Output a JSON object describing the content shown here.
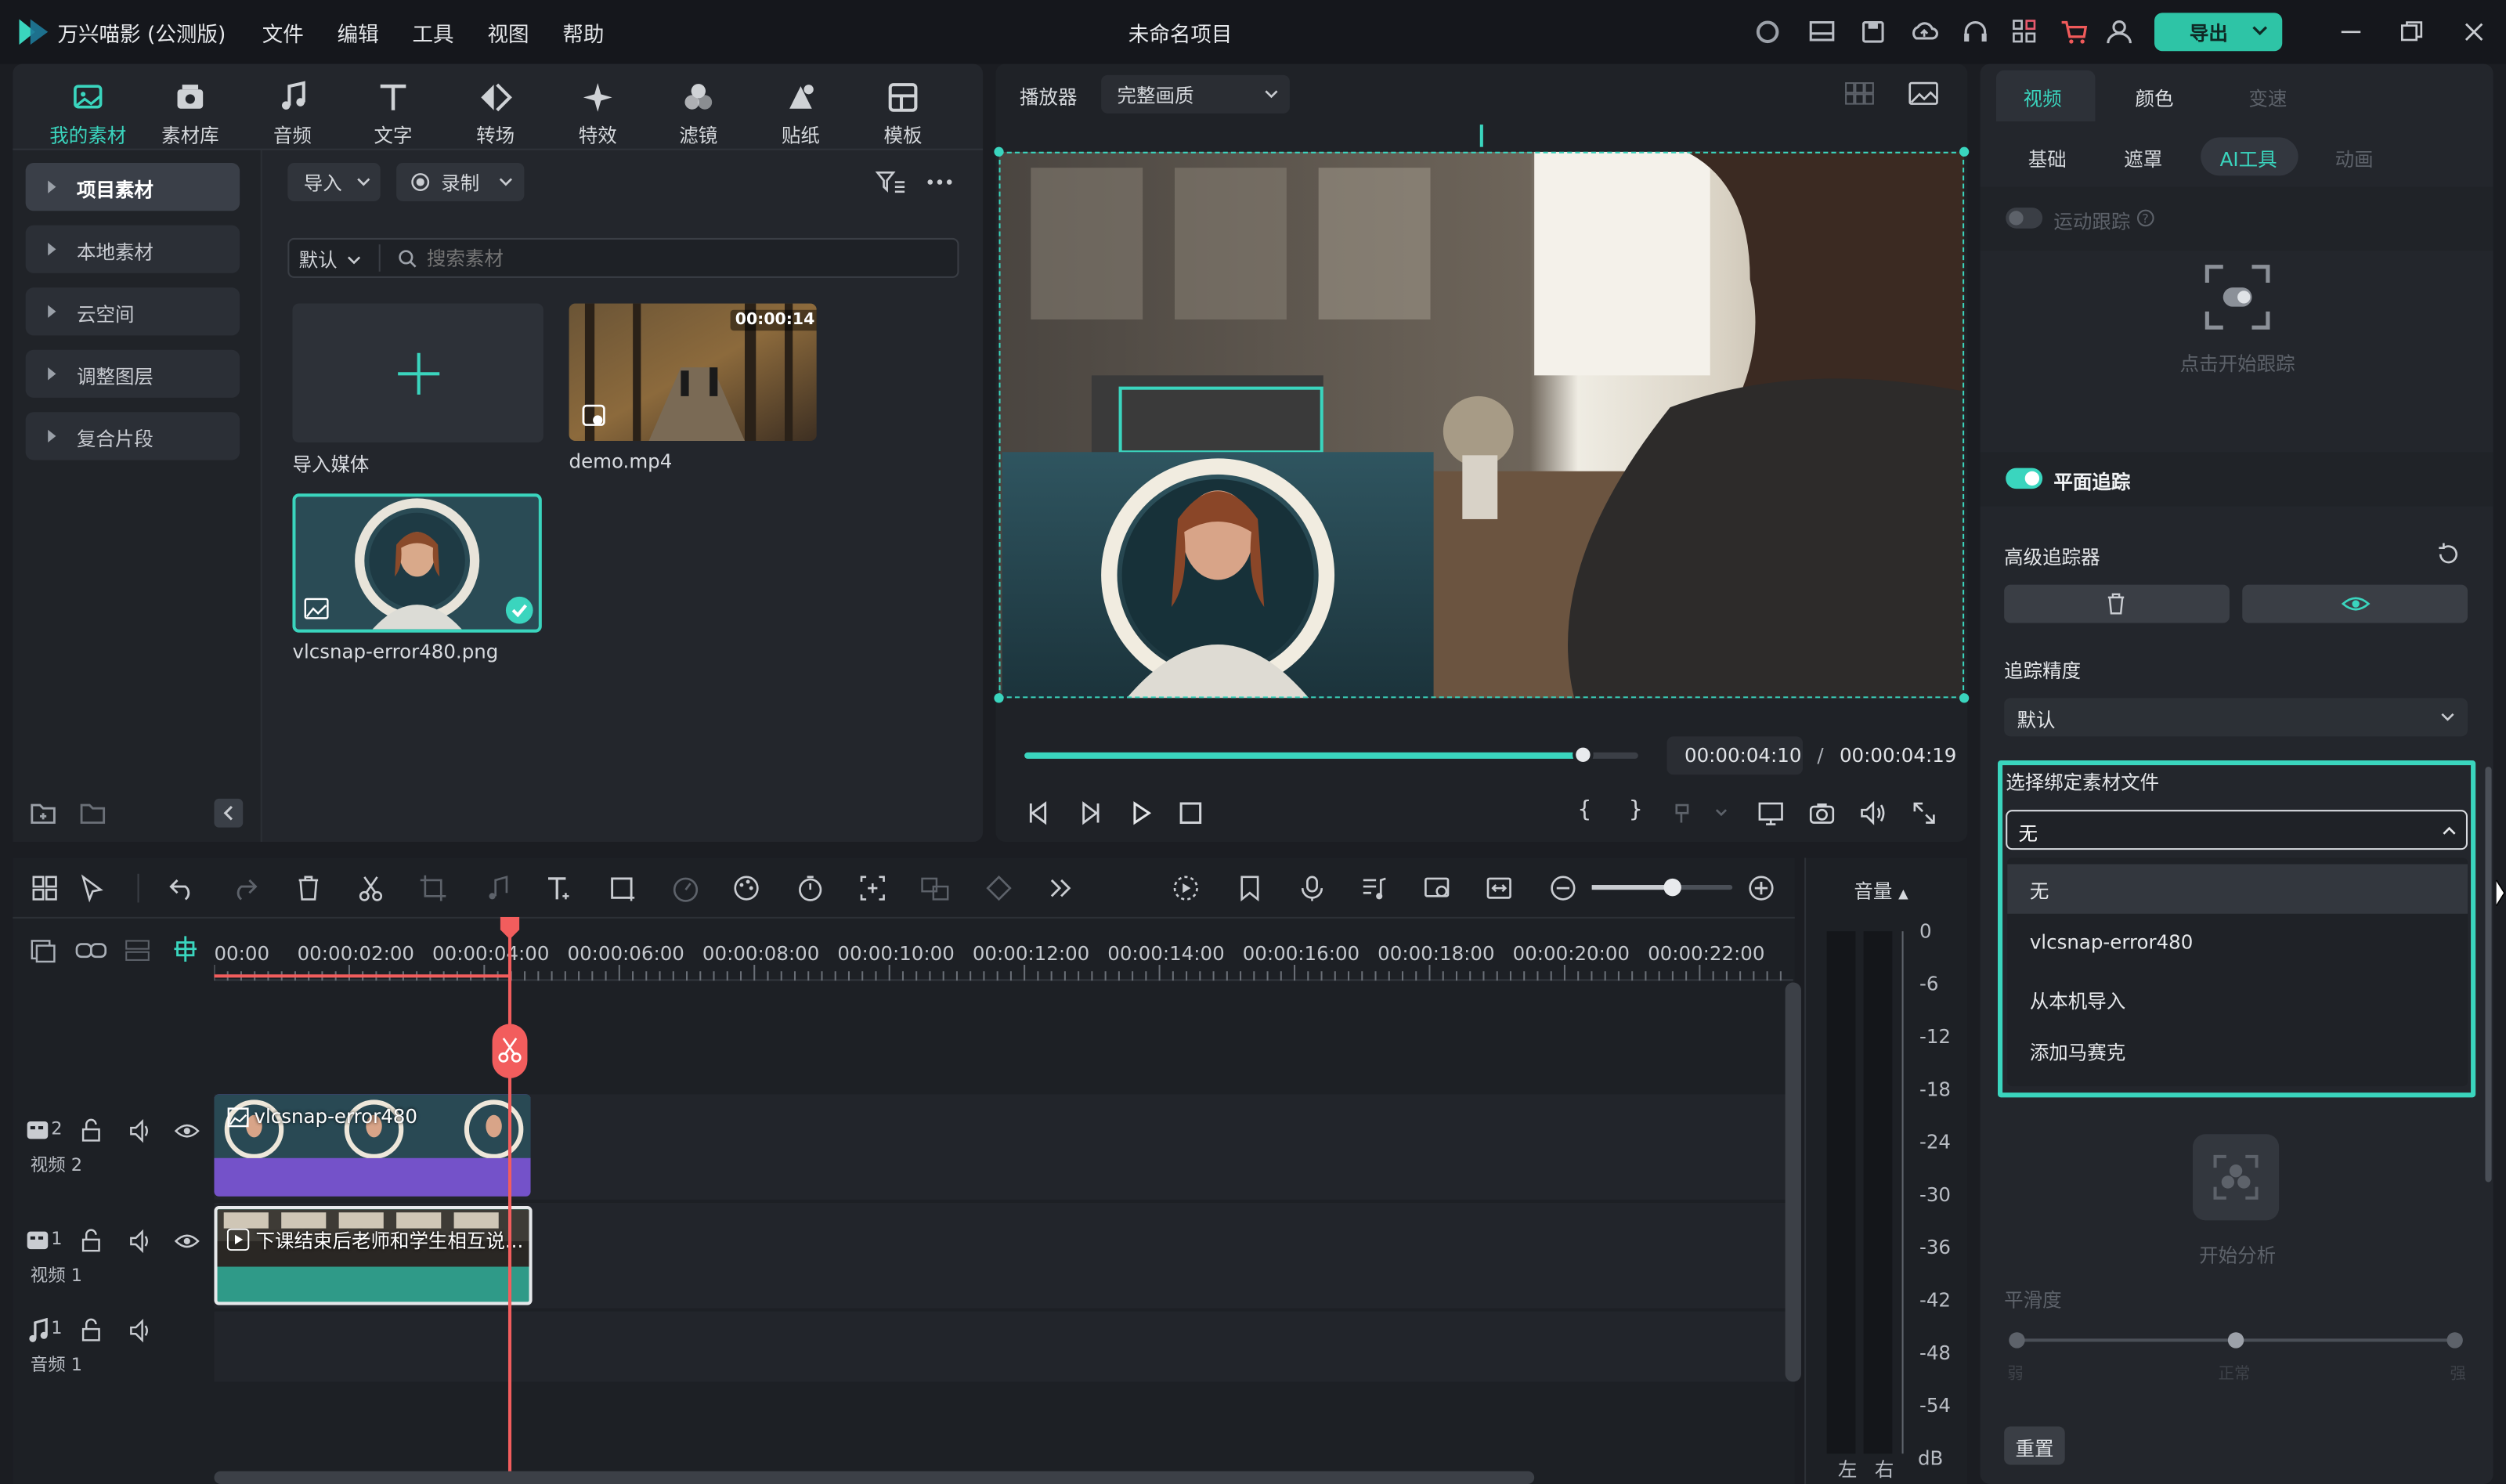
{
  "app": {
    "title": "万兴喵影 (公测版)",
    "project_title": "未命名项目",
    "export_label": "导出"
  },
  "menu": [
    "文件",
    "编辑",
    "工具",
    "视图",
    "帮助"
  ],
  "media_tabs": [
    "我的素材",
    "素材库",
    "音频",
    "文字",
    "转场",
    "特效",
    "滤镜",
    "贴纸",
    "模板"
  ],
  "sidebar": [
    "项目素材",
    "本地素材",
    "云空间",
    "调整图层",
    "复合片段"
  ],
  "media_toolbar": {
    "import": "导入",
    "record": "录制",
    "sort": "默认",
    "search_placeholder": "搜索素材"
  },
  "media_items": [
    {
      "name": "导入媒体"
    },
    {
      "name": "demo.mp4",
      "duration": "00:00:14"
    },
    {
      "name": "vlcsnap-error480.png"
    }
  ],
  "player": {
    "label": "播放器",
    "quality": "完整画质",
    "current_time": "00:00:04:10",
    "separator": "/",
    "total_time": "00:00:04:19",
    "progress": 0.91
  },
  "timeline": {
    "ruler": [
      "00:00",
      "00:00:02:00",
      "00:00:04:00",
      "00:00:06:00",
      "00:00:08:00",
      "00:00:10:00",
      "00:00:12:00",
      "00:00:14:00",
      "00:00:16:00",
      "00:00:18:00",
      "00:00:20:00",
      "00:00:22:00"
    ],
    "tracks": [
      {
        "num": "2",
        "name": "视频 2",
        "clip": "vlcsnap-error480"
      },
      {
        "num": "1",
        "name": "视频 1",
        "clip": "下课结束后老师和学生相互说..."
      },
      {
        "num": "1",
        "name": "音频 1"
      }
    ],
    "volume_label": "音量",
    "meter_scale": [
      "0",
      "-6",
      "-12",
      "-18",
      "-24",
      "-30",
      "-36",
      "-42",
      "-48",
      "-54",
      "dB"
    ],
    "meter_lr": [
      "左",
      "右"
    ]
  },
  "right_panel": {
    "tabs": [
      "视频",
      "颜色",
      "变速"
    ],
    "subtabs": [
      "基础",
      "遮罩",
      "AI工具",
      "动画"
    ],
    "motion_tracking": "运动跟踪",
    "click_to_track": "点击开始跟踪",
    "planar_tracking": "平面追踪",
    "advanced_tracker": "高级追踪器",
    "precision_label": "追踪精度",
    "precision_value": "默认",
    "bind_label": "选择绑定素材文件",
    "bind_value": "无",
    "bind_options": [
      "无",
      "vlcsnap-error480",
      "从本机导入",
      "添加马赛克"
    ],
    "analyze": "开始分析",
    "smooth": "平滑度",
    "smooth_marks": [
      "弱",
      "正常",
      "强"
    ],
    "reset": "重置"
  },
  "colors": {
    "accent": "#3ad5be",
    "export": "#2ec4a6",
    "playhead": "#f25d5d",
    "video2_clip": "#7452c9",
    "video1_clip": "#2f9a88"
  }
}
